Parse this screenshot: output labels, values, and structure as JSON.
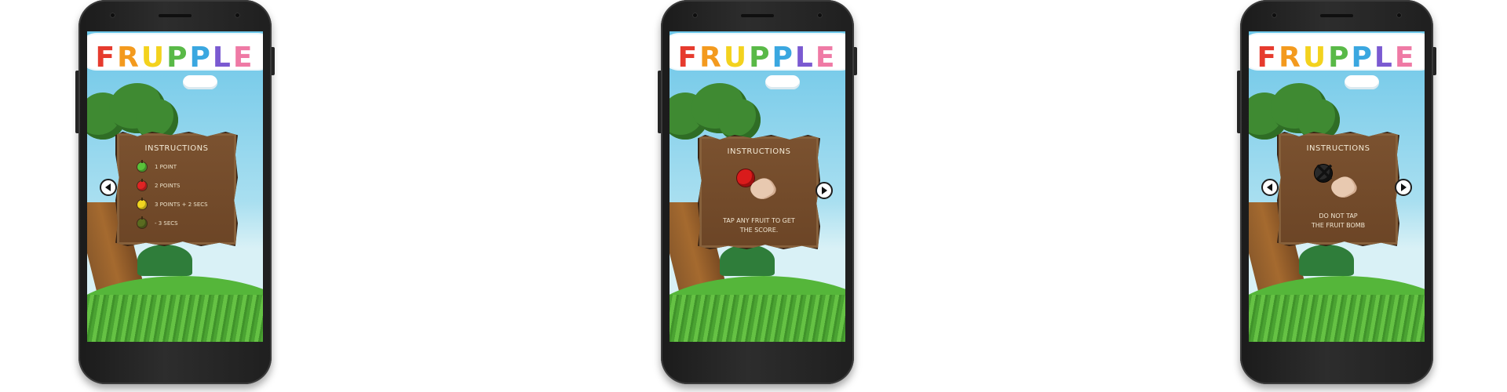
{
  "app": {
    "title_letters": [
      {
        "char": "F",
        "color": "#e63b2e"
      },
      {
        "char": "R",
        "color": "#f39a1e"
      },
      {
        "char": "U",
        "color": "#f3d21e"
      },
      {
        "char": "P",
        "color": "#59b947"
      },
      {
        "char": "P",
        "color": "#3aa7e0"
      },
      {
        "char": "L",
        "color": "#7a5ad1"
      },
      {
        "char": "E",
        "color": "#ef7aa5"
      }
    ]
  },
  "screens": [
    {
      "board_title": "INSTRUCTIONS",
      "legend": [
        {
          "text": "1 POINT",
          "fruit_color": "#59c23a",
          "icon": "green-apple-icon"
        },
        {
          "text": "2 POINTS",
          "fruit_color": "#e02424",
          "icon": "red-apple-icon"
        },
        {
          "text": "3 POINTS + 2 SECS",
          "fruit_color": "#f1d520",
          "icon": "yellow-apple-icon"
        },
        {
          "text": "- 3 SECS",
          "fruit_color": "#5a6b20",
          "icon": "rotten-apple-icon"
        }
      ],
      "nav": {
        "prev_icon": "arrow-left-icon"
      }
    },
    {
      "board_title": "INSTRUCTIONS",
      "caption_line1": "TAP ANY FRUIT TO GET",
      "caption_line2": "THE SCORE.",
      "nav": {
        "next_icon": "arrow-right-icon"
      }
    },
    {
      "board_title": "INSTRUCTIONS",
      "caption_line1": "DO NOT TAP",
      "caption_line2": "THE FRUIT BOMB",
      "nav": {
        "prev_icon": "arrow-left-icon",
        "next_icon": "arrow-right-icon"
      }
    }
  ]
}
